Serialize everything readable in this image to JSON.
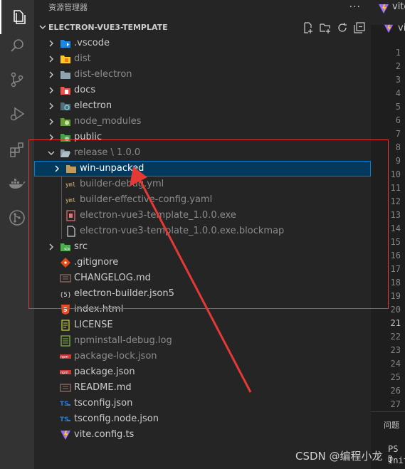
{
  "sidebar": {
    "title": "资源管理器",
    "more_label": "···",
    "root_label": "ELECTRON-VUE3-TEMPLATE"
  },
  "tree": {
    "vscode": ".vscode",
    "dist": "dist",
    "dist_electron": "dist-electron",
    "docs": "docs",
    "electron": "electron",
    "node_modules": "node_modules",
    "public": "public",
    "release": "release \\ 1.0.0",
    "win_unpacked": "win-unpacked",
    "builder_debug": "builder-debug.yml",
    "builder_effective": "builder-effective-config.yaml",
    "exe": "electron-vue3-template_1.0.0.exe",
    "blockmap": "electron-vue3-template_1.0.0.exe.blockmap",
    "src": "src",
    "gitignore": ".gitignore",
    "changelog": "CHANGELOG.md",
    "builder_json5": "electron-builder.json5",
    "index_html": "index.html",
    "license": "LICENSE",
    "npminstall_log": "npminstall-debug.log",
    "package_lock": "package-lock.json",
    "package_json": "package.json",
    "readme": "README.md",
    "tsconfig": "tsconfig.json",
    "tsconfig_node": "tsconfig.node.json",
    "vite_config": "vite.config.ts"
  },
  "editor": {
    "tab_label": "vite",
    "breadcrumb_label": "vi",
    "line_numbers": [
      "1",
      "2",
      "3",
      "4",
      "5",
      "6",
      "7",
      "8",
      "9",
      "10",
      "11",
      "12",
      "13",
      "14",
      "15",
      "16",
      "17",
      "18",
      "19",
      "20",
      "21",
      "22",
      "23",
      "24",
      "25",
      "26",
      "27"
    ],
    "current_line": 21,
    "panel_tab": "问题",
    "terminal_line1": "PS D",
    "terminal_line2": "Init"
  },
  "watermark": "CSDN @编程小龙",
  "colors": {
    "background": "#1e1e1e",
    "sidebar": "#252526",
    "activity_bar": "#333333",
    "selection": "#04395e",
    "annotation_red": "#e53935"
  }
}
